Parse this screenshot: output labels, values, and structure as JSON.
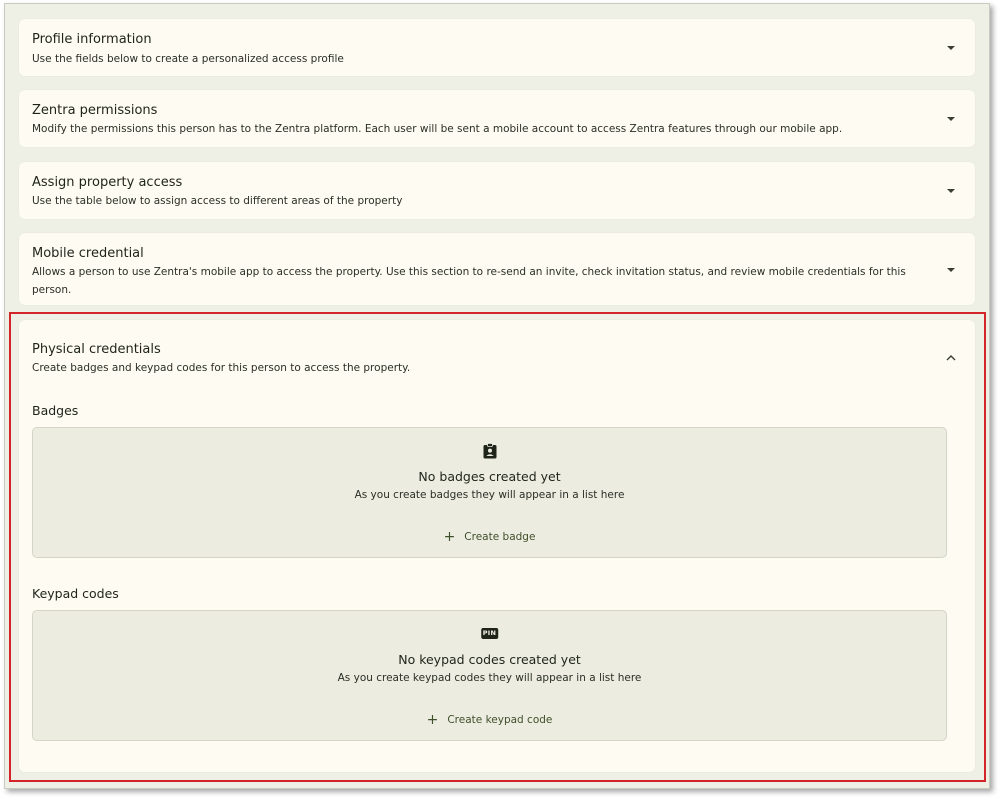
{
  "sections": [
    {
      "title": "Profile information",
      "description": "Use the fields below to create a personalized access profile",
      "expanded": false
    },
    {
      "title": "Zentra permissions",
      "description": "Modify the permissions this person has to the Zentra platform. Each user will be sent a mobile account to access Zentra features through our mobile app.",
      "expanded": false
    },
    {
      "title": "Assign property access",
      "description": "Use the table below to assign access to different areas of the property",
      "expanded": false
    },
    {
      "title": "Mobile credential",
      "description": "Allows a person to use Zentra's mobile app to access the property. Use this section to re-send an invite, check invitation status, and review mobile credentials for this person.",
      "expanded": false
    }
  ],
  "physical": {
    "title": "Physical credentials",
    "description": "Create badges and keypad codes for this person to access the property.",
    "expanded": true,
    "badges": {
      "label": "Badges",
      "icon": "badge-icon",
      "empty_title": "No badges created yet",
      "empty_sub": "As you create badges they will appear in a list here",
      "button": "Create badge"
    },
    "keypad": {
      "label": "Keypad codes",
      "icon": "pin-icon",
      "icon_text": "PIN",
      "empty_title": "No keypad codes created yet",
      "empty_sub": "As you create keypad codes they will appear in a list here",
      "button": "Create keypad code"
    }
  },
  "colors": {
    "card_bg": "#fdfbf2",
    "page_bg": "#eef0e6",
    "empty_bg": "#ecece1",
    "accent_text": "#3f4f2a",
    "highlight": "#d3242a"
  }
}
